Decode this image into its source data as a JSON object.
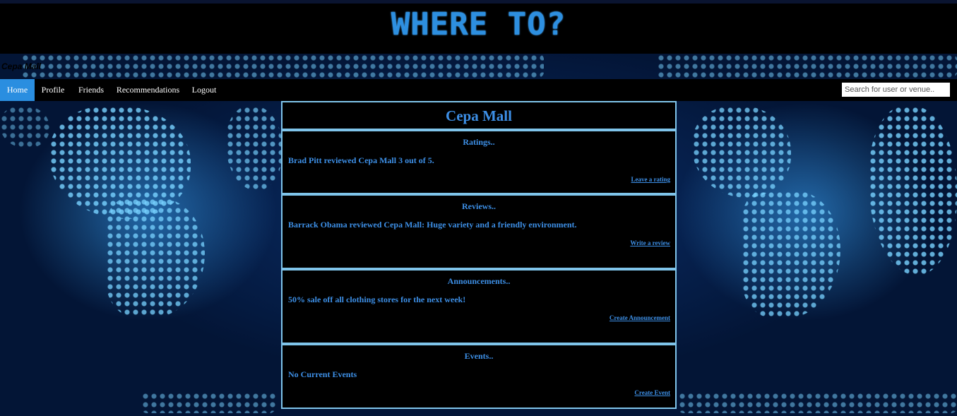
{
  "header": {
    "logo_text": "WHERE TO?"
  },
  "venue_tag": "Cepa Mall",
  "nav": {
    "items": [
      {
        "label": "Home",
        "active": true
      },
      {
        "label": "Profile",
        "active": false
      },
      {
        "label": "Friends",
        "active": false
      },
      {
        "label": "Recommendations",
        "active": false
      },
      {
        "label": "Logout",
        "active": false
      }
    ],
    "search_placeholder": "Search for user or venue.."
  },
  "venue": {
    "title": "Cepa Mall"
  },
  "sections": {
    "ratings": {
      "heading": "Ratings..",
      "body": "Brad Pitt reviewed Cepa Mall 3 out of 5.",
      "link": "Leave a rating"
    },
    "reviews": {
      "heading": "Reviews..",
      "body": "Barrack Obama reviewed Cepa Mall: Huge variety and a friendly environment.",
      "link": "Write a review"
    },
    "announcements": {
      "heading": "Announcements..",
      "body": "50% sale off all clothing stores for the next week!",
      "link": "Create Announcement"
    },
    "events": {
      "heading": "Events..",
      "body": "No Current Events",
      "link": "Create Event"
    }
  },
  "colors": {
    "accent": "#2a8ee0",
    "text_blue": "#3d8fe6",
    "panel_border": "#7fc4ea"
  }
}
